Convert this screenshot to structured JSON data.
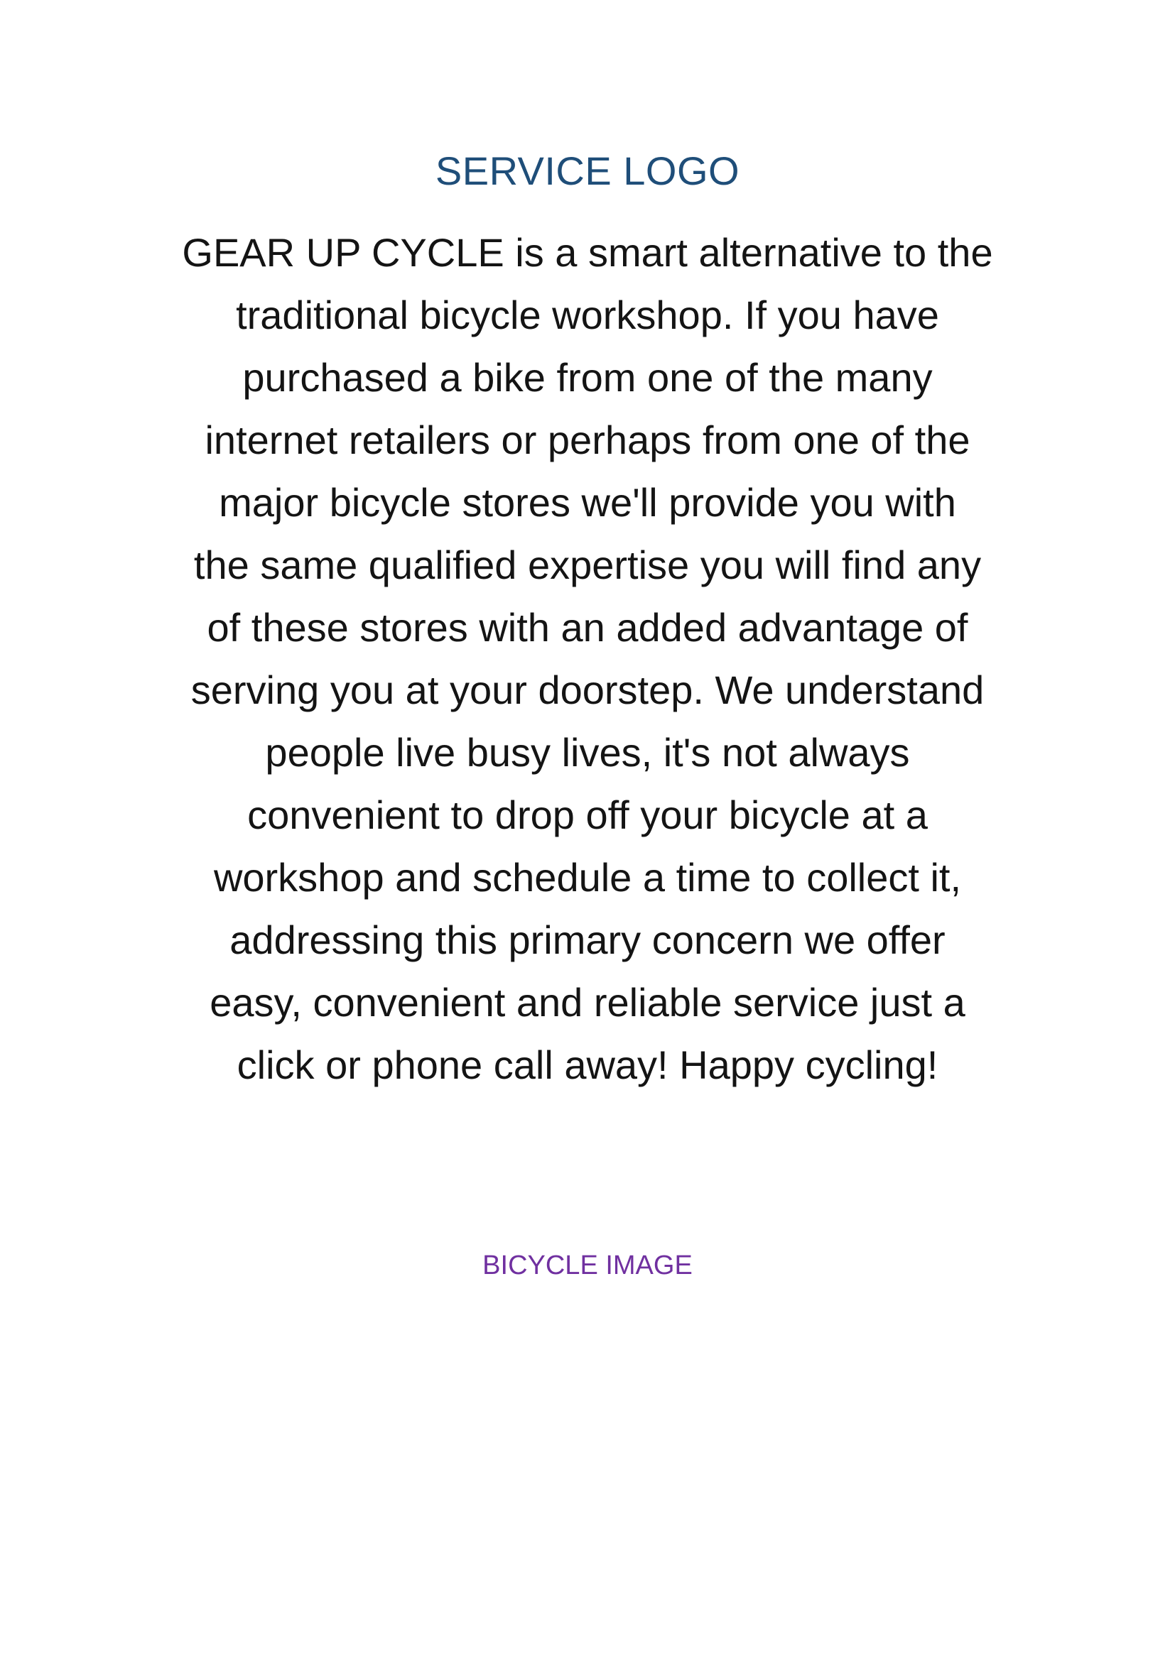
{
  "header": {
    "logo_text": "SERVICE LOGO"
  },
  "main": {
    "description_lines": [
      "GEAR UP CYCLE is a smart alternative to the",
      "traditional bicycle workshop. If you have",
      "purchased a bike from one of the many",
      "internet retailers or perhaps from one of the",
      "major bicycle stores we'll provide you with",
      "the same qualified expertise you will find any",
      "of these stores with an added advantage of",
      "serving you at your doorstep. We understand",
      "people live busy lives, it's not always",
      "convenient to drop off your bicycle at a",
      "workshop and schedule a time to collect it,",
      "addressing this primary concern we offer",
      "easy, convenient and reliable service just a",
      "click or phone call away! Happy cycling!"
    ],
    "image_text": "BICYCLE IMAGE"
  },
  "colors": {
    "logo_text": "#1f4e79",
    "body_text": "#141414",
    "image_text": "#7030a0",
    "background": "#ffffff"
  }
}
